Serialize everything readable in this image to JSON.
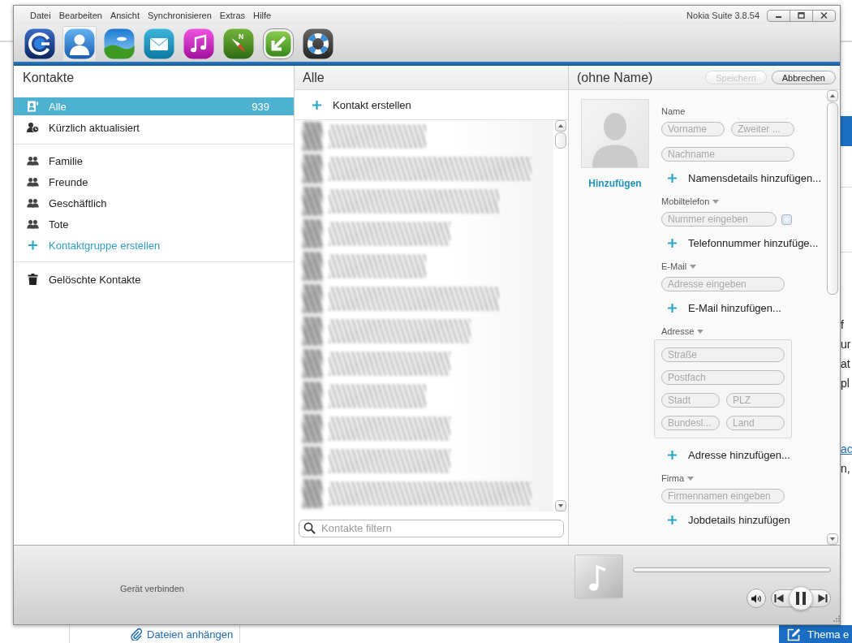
{
  "window": {
    "menu": [
      "Datei",
      "Bearbeiten",
      "Ansicht",
      "Synchronisieren",
      "Extras",
      "Hilfe"
    ],
    "title": "Nokia Suite 3.8.54"
  },
  "toolbar": [
    {
      "kind": "home",
      "selected": false
    },
    {
      "kind": "contacts",
      "selected": true
    },
    {
      "kind": "photos",
      "selected": false
    },
    {
      "kind": "messages",
      "selected": false
    },
    {
      "kind": "music",
      "selected": false
    },
    {
      "kind": "maps",
      "letter": "N",
      "selected": false
    },
    {
      "kind": "update",
      "selected": false
    },
    {
      "kind": "support",
      "selected": false
    }
  ],
  "sidebar": {
    "title": "Kontakte",
    "sections": [
      {
        "items": [
          {
            "kind": "all",
            "label": "Alle",
            "count": "939",
            "selected": true
          },
          {
            "kind": "recent",
            "label": "Kürzlich aktualisiert",
            "selected": false
          }
        ]
      },
      {
        "items": [
          {
            "kind": "group",
            "label": "Familie",
            "selected": false
          },
          {
            "kind": "group",
            "label": "Freunde",
            "selected": false
          },
          {
            "kind": "group",
            "label": "Geschäftlich",
            "selected": false
          },
          {
            "kind": "group",
            "label": "Tote",
            "selected": false
          },
          {
            "kind": "create",
            "label": "Kontaktgruppe erstellen",
            "selected": false
          }
        ]
      },
      {
        "items": [
          {
            "kind": "trash",
            "label": "Gelöschte Kontakte",
            "selected": false
          }
        ]
      }
    ]
  },
  "contact_list": {
    "title": "Alle",
    "create_label": "Kontakt erstellen",
    "filter": {
      "placeholder": "Kontakte filtern"
    }
  },
  "contact_form": {
    "title": "(ohne Name)",
    "buttons": [
      {
        "label": "Speichern",
        "disabled": true
      },
      {
        "label": "Abbrechen",
        "disabled": false
      }
    ],
    "photo_link": "Hinzufügen",
    "sections": [
      {
        "label": "Name",
        "dropdown": false,
        "kind": "name",
        "rows": [
          [
            {
              "placeholder": "Vorname"
            },
            {
              "placeholder": "Zweiter ..."
            }
          ],
          [
            {
              "placeholder": "Nachname"
            }
          ]
        ],
        "add": "Namensdetails hinzufügen..."
      },
      {
        "label": "Mobiltelefon",
        "dropdown": true,
        "kind": "plain",
        "rows": [
          [
            {
              "placeholder": "Nummer eingeben",
              "checkbox": {
                "checked": false
              }
            }
          ]
        ],
        "add": "Telefonnummer hinzufüge..."
      },
      {
        "label": "E-Mail",
        "dropdown": true,
        "kind": "plain",
        "rows": [
          [
            {
              "placeholder": "Adresse eingeben"
            }
          ]
        ],
        "add": "E-Mail hinzufügen..."
      },
      {
        "label": "Adresse",
        "dropdown": true,
        "kind": "boxed",
        "rows": [
          [
            {
              "placeholder": "Straße"
            }
          ],
          [
            {
              "placeholder": "Postfach"
            }
          ],
          [
            {
              "placeholder": "Stadt"
            },
            {
              "placeholder": "PLZ"
            }
          ],
          [
            {
              "placeholder": "Bundesl..."
            },
            {
              "placeholder": "Land"
            }
          ]
        ],
        "add": "Adresse hinzufügen..."
      },
      {
        "label": "Firma",
        "dropdown": true,
        "kind": "plain",
        "rows": [
          [
            {
              "placeholder": "Firmennamen eingeben"
            }
          ]
        ],
        "add": "Jobdetails hinzufügen"
      }
    ]
  },
  "bottom_bar": {
    "status": "Gerät verbinden"
  },
  "background_page": {
    "side_fragments": [
      {
        "kind": "text",
        "text": "f"
      },
      {
        "kind": "text",
        "text": "ur"
      },
      {
        "kind": "text",
        "text": "at"
      },
      {
        "kind": "text",
        "text": "pl"
      },
      {
        "kind": "link",
        "text": "ac"
      },
      {
        "kind": "text",
        "text": "n,"
      }
    ],
    "attach_link": "Dateien anhängen",
    "new_topic_button": "Thema e"
  }
}
